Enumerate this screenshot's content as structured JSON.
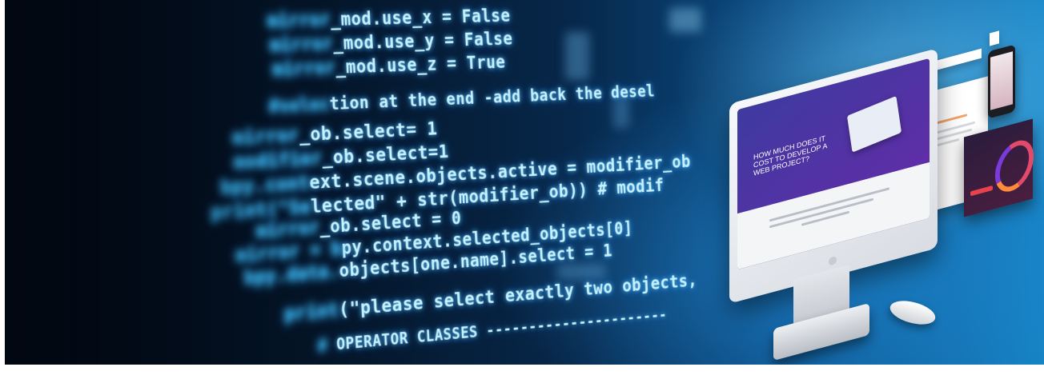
{
  "code_lines": [
    {
      "prefix": "mirror",
      "text": "_mod.use_x = False"
    },
    {
      "prefix": "mirror",
      "text": "_mod.use_y = False"
    },
    {
      "prefix": "mirror",
      "text": "_mod.use_z = True"
    },
    {
      "prefix": "#selec",
      "text": "tion at the end -add back the desel"
    },
    {
      "prefix": "mirror",
      "text": "_ob.select= 1"
    },
    {
      "prefix": "modifier",
      "text": "_ob.select=1"
    },
    {
      "prefix": "bpy.cont",
      "text": "ext.scene.objects.active = modifier_ob"
    },
    {
      "prefix": "print(\"Se",
      "text": "lected\" + str(modifier_ob)) # modif"
    },
    {
      "prefix": "mirror",
      "text": "_ob.select = 0"
    },
    {
      "prefix": "mirror = b",
      "text": "py.context.selected_objects[0]"
    },
    {
      "prefix": "bpy.data.",
      "text": "objects[one.name].select = 1"
    },
    {
      "prefix": "print",
      "text": "(\"please select exactly two objects,"
    },
    {
      "prefix": "# ",
      "text": "OPERATOR CLASSES ----------------------"
    }
  ],
  "screen": {
    "hero_text": "HOW MUCH DOES IT COST TO DEVELOP A WEB PROJECT?"
  },
  "colors": {
    "code_glow": "#c9f2ff",
    "screen_accent": "#5b2fa6",
    "background_dark": "#041426",
    "background_light": "#1784c6"
  }
}
